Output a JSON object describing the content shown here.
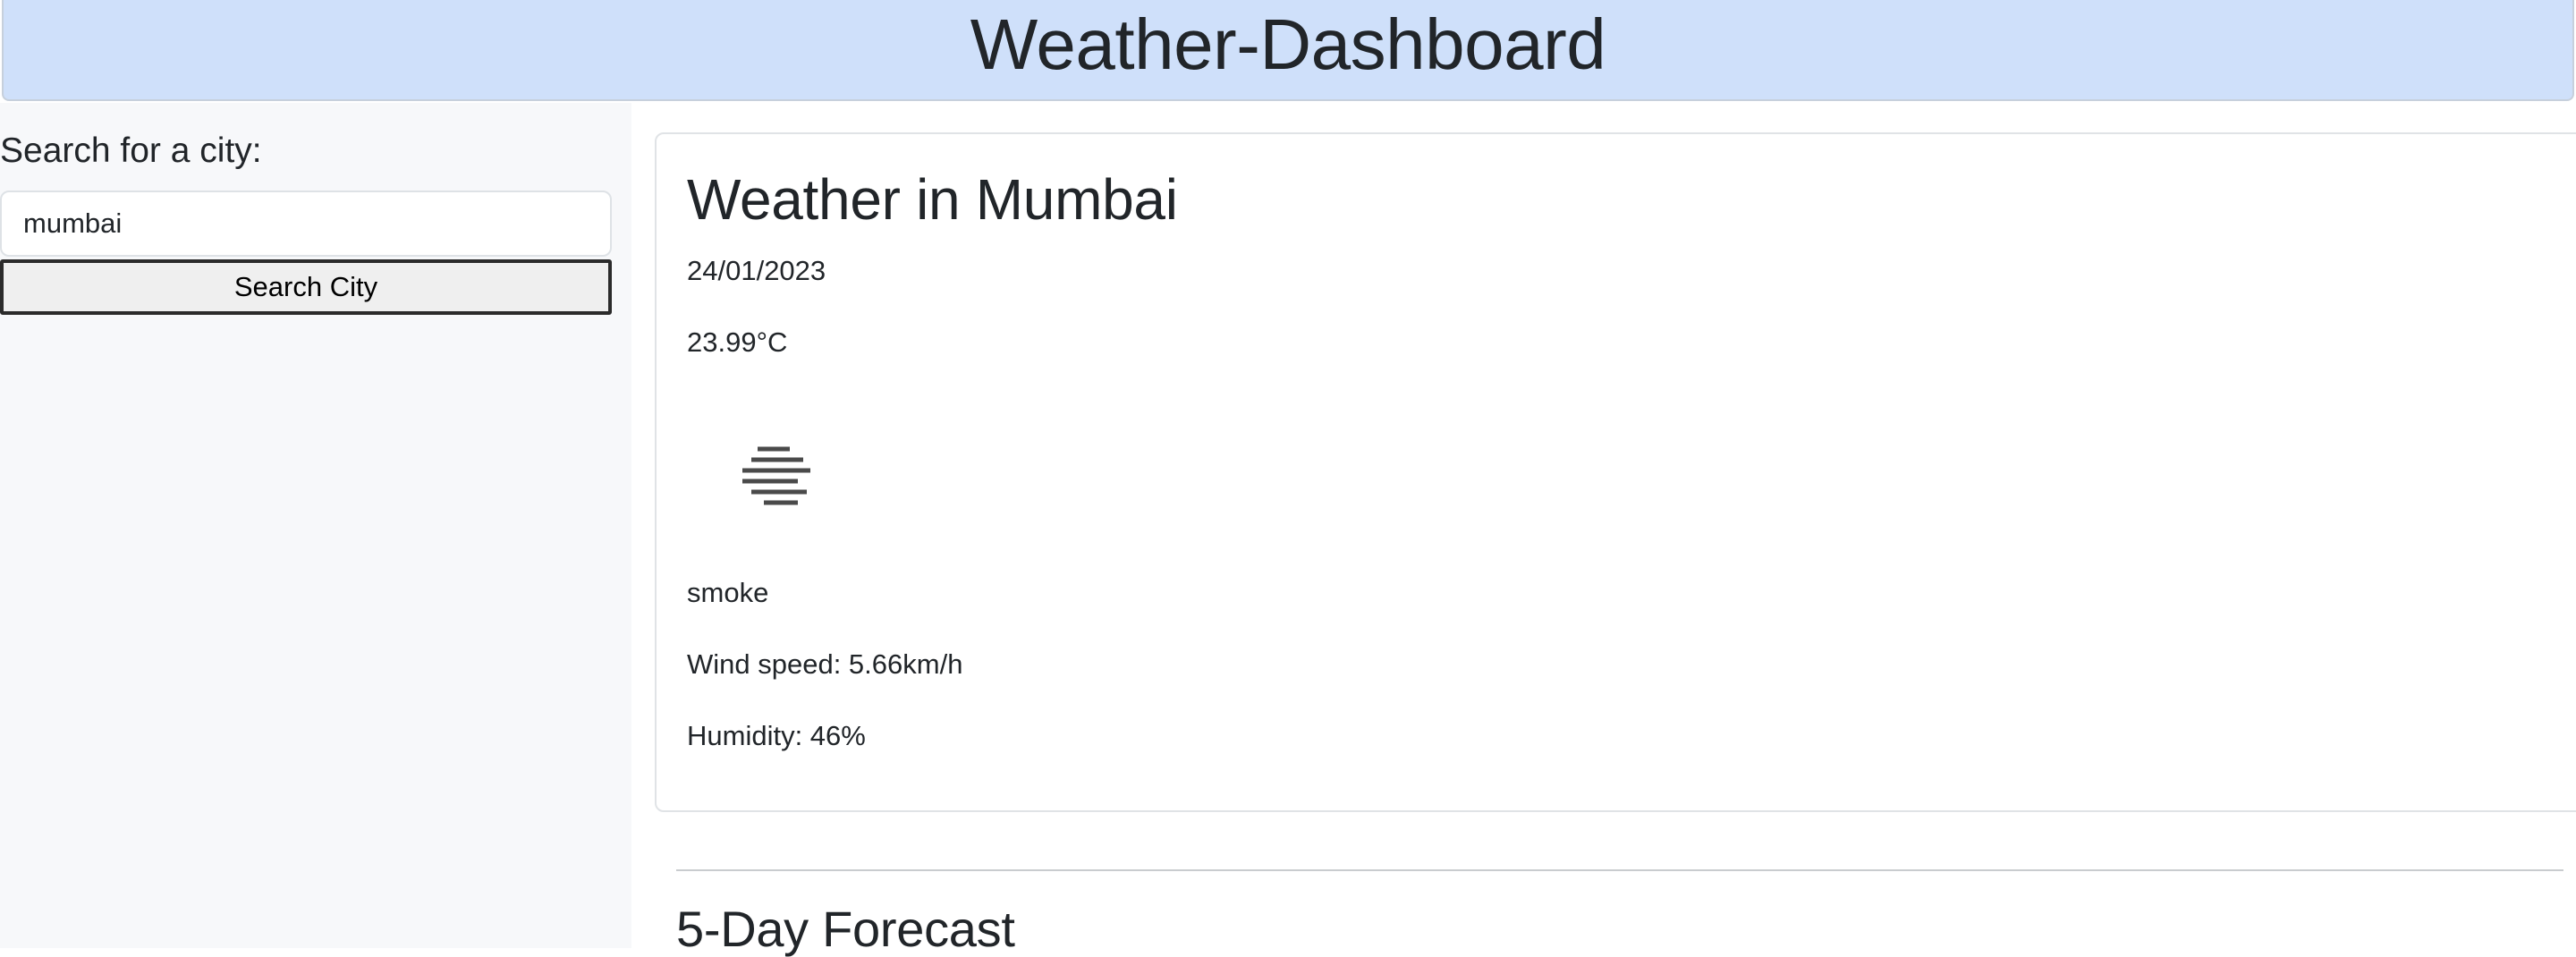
{
  "header": {
    "title": "Weather-Dashboard"
  },
  "sidebar": {
    "search_label": "Search for a city:",
    "search_value": "mumbai",
    "search_button_label": "Search City"
  },
  "current": {
    "title": "Weather in Mumbai",
    "date": "24/01/2023",
    "temperature": "23.99°C",
    "icon": "smoke-haze-icon",
    "description": "smoke",
    "wind": "Wind speed: 5.66km/h",
    "humidity": "Humidity: 46%"
  },
  "forecast": {
    "title": "5-Day Forecast"
  }
}
